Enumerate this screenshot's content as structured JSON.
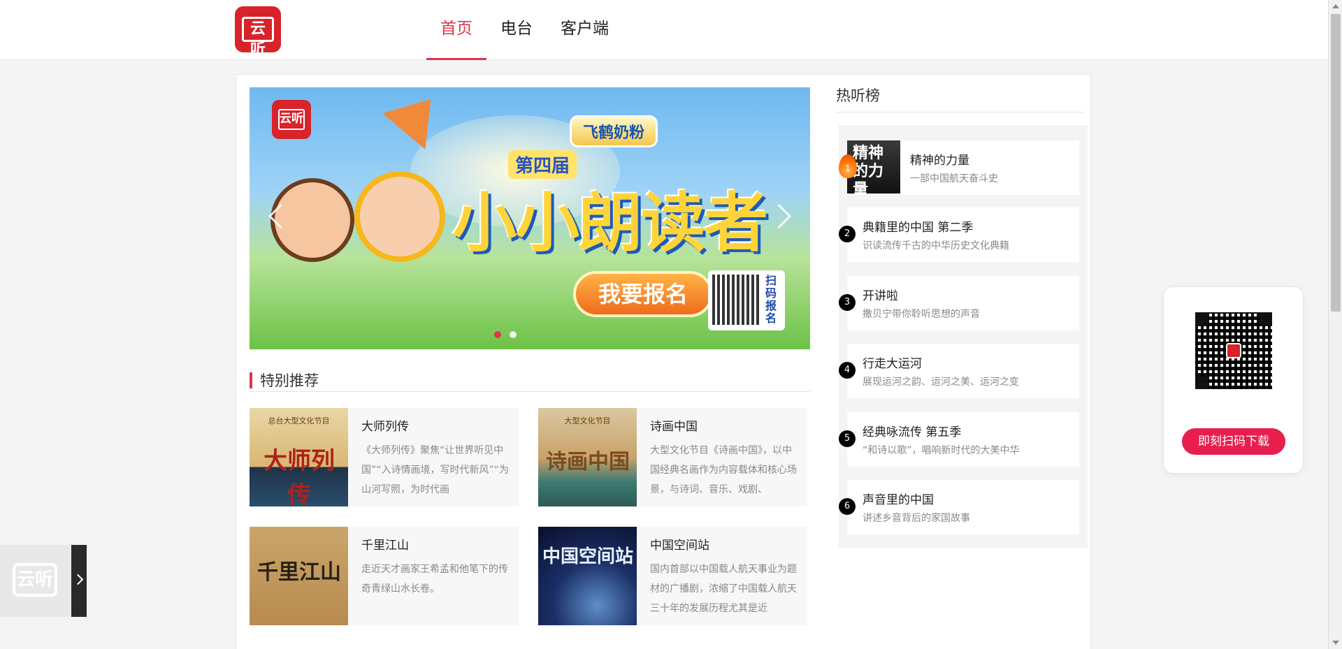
{
  "header": {
    "logo_text": "云听",
    "nav": [
      {
        "label": "首页",
        "active": true
      },
      {
        "label": "电台",
        "active": false
      },
      {
        "label": "客户端",
        "active": false
      }
    ]
  },
  "banner": {
    "logo_text": "云听",
    "sponsor": "飞鹤奶粉",
    "subtitle": "第四届",
    "headline": "小小朗读者",
    "cta": "我要报名",
    "qr_text": "扫码报名",
    "slide_count": 2,
    "active_slide": 1
  },
  "recommend": {
    "title": "特别推荐",
    "items": [
      {
        "title": "大师列传",
        "cover_text": "大师列传",
        "cover_small": "总台大型文化节目",
        "desc": "《大师列传》聚焦“让世界听见中国”“入诗情画境，写时代新风”“为山河写照，为时代画"
      },
      {
        "title": "诗画中国",
        "cover_text": "诗画中国",
        "cover_small": "大型文化节目",
        "desc": "大型文化节目《诗画中国》，以中国经典名画作为内容载体和核心场景，与诗词、音乐、戏剧、"
      },
      {
        "title": "千里江山",
        "cover_text": "千里江山",
        "cover_small": "",
        "desc": "走近天才画家王希孟和他笔下的传奇青绿山水长卷。"
      },
      {
        "title": "中国空间站",
        "cover_text": "中国空间站",
        "cover_small": "",
        "desc": "国内首部以中国载人航天事业为题材的广播剧，浓缩了中国载人航天三十年的发展历程尤其是近"
      }
    ]
  },
  "hot": {
    "title": "热听榜",
    "items": [
      {
        "rank": "1",
        "name": "精神的力量",
        "sub": "一部中国航天奋斗史",
        "cover_text": "精神的力量"
      },
      {
        "rank": "2",
        "name": "典籍里的中国  第二季",
        "sub": "识读流传千古的中华历史文化典籍"
      },
      {
        "rank": "3",
        "name": "开讲啦",
        "sub": "撒贝宁带你聆听思想的声音"
      },
      {
        "rank": "4",
        "name": "行走大运河",
        "sub": "展现运河之韵、运河之美、运河之变"
      },
      {
        "rank": "5",
        "name": "经典咏流传  第五季",
        "sub": "“和诗以歌”，唱响新时代的大美中华"
      },
      {
        "rank": "6",
        "name": "声音里的中国",
        "sub": "讲述乡音背后的家国故事"
      }
    ]
  },
  "download": {
    "button": "即刻扫码下载"
  },
  "side_tab": {
    "logo_text": "云听"
  },
  "colors": {
    "accent": "#e0344a",
    "brand": "#d8232a",
    "download_button": "#e81e4f"
  }
}
